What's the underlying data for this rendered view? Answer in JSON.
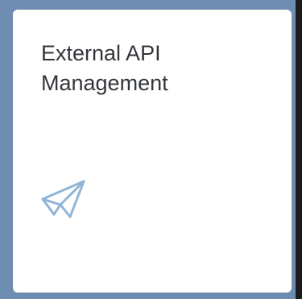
{
  "tile": {
    "title_line1": "External API",
    "title_line2": "Management",
    "icon": "paper-plane-icon",
    "icon_color": "#8fb6d6",
    "background_color": "#ffffff",
    "frame_color": "#6f8db0"
  }
}
